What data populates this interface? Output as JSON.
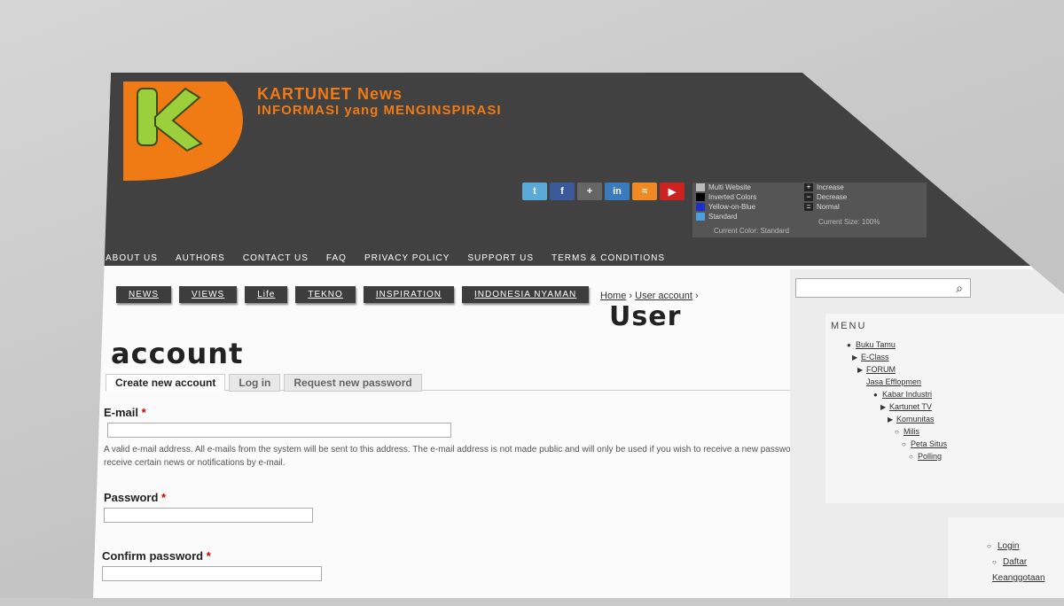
{
  "site": {
    "name": "KARTUNET News",
    "slogan": "INFORMASI yang MENGINSPIRASI",
    "logo_letter": "K",
    "brand_orange": "#f07a14",
    "logo_green": "#9ccf3c"
  },
  "share_icons": [
    {
      "icon": "twitter-icon",
      "glyph": "t",
      "color": "#5aa9d6"
    },
    {
      "icon": "facebook-icon",
      "glyph": "f",
      "color": "#3b5998"
    },
    {
      "icon": "google-plus-icon",
      "glyph": "+",
      "color": "#666666"
    },
    {
      "icon": "linkedin-icon",
      "glyph": "in",
      "color": "#3a7bbd"
    },
    {
      "icon": "rss-icon",
      "glyph": "≈",
      "color": "#f08a24"
    },
    {
      "icon": "youtube-icon",
      "glyph": "▶",
      "color": "#cc2222"
    }
  ],
  "theme_switcher": {
    "options": [
      "Multi Website",
      "Inverted Colors",
      "Yellow-on-Blue",
      "Standard"
    ],
    "current": "Current Color: Standard"
  },
  "text_size": {
    "options": [
      "Increase",
      "Decrease",
      "Normal"
    ],
    "glyphs": [
      "+",
      "−",
      "="
    ],
    "current": "Current Size: 100%"
  },
  "top_nav": [
    "ABOUT US",
    "AUTHORS",
    "CONTACT US",
    "FAQ",
    "PRIVACY POLICY",
    "SUPPORT US",
    "TERMS & CONDITIONS"
  ],
  "sub_tabs": [
    "NEWS",
    "VIEWS",
    "Life",
    "TEKNO",
    "INSPIRATION",
    "INDONESIA NYAMAN"
  ],
  "breadcrumb": {
    "home": "Home",
    "sep": " › ",
    "current": "User account",
    "trail": " ›"
  },
  "page_title": {
    "line1": "User",
    "line2": "account"
  },
  "tabs": [
    "Create new account",
    "Log in",
    "Request new password"
  ],
  "form": {
    "email_label": "E-mail",
    "required_mark": "*",
    "email_desc": "A valid e-mail address. All e-mails from the system will be sent to this address. The e-mail address is not made public and will only be used if you wish to receive a new password or wish to receive certain news or notifications by e-mail.",
    "password_label": "Password",
    "confirm_label": "Confirm password"
  },
  "search": {
    "button_glyph": "⌕"
  },
  "menu": {
    "title": "MENU",
    "items": [
      {
        "label": "Buku Tamu",
        "indent": 40
      },
      {
        "label": "E-Class",
        "indent": 47
      },
      {
        "label": "FORUM",
        "indent": 54
      },
      {
        "label": "Jasa Efflopmen",
        "indent": 62
      },
      {
        "label": "Kabar Industri",
        "indent": 70
      },
      {
        "label": "Kartunet TV",
        "indent": 78
      },
      {
        "label": "Komunitas",
        "indent": 86
      },
      {
        "label": "Milis",
        "indent": 94
      },
      {
        "label": "Peta Situs",
        "indent": 102
      },
      {
        "label": "Polling",
        "indent": 110
      }
    ]
  },
  "user_menu": [
    "Login",
    "Daftar Keanggotaan"
  ]
}
